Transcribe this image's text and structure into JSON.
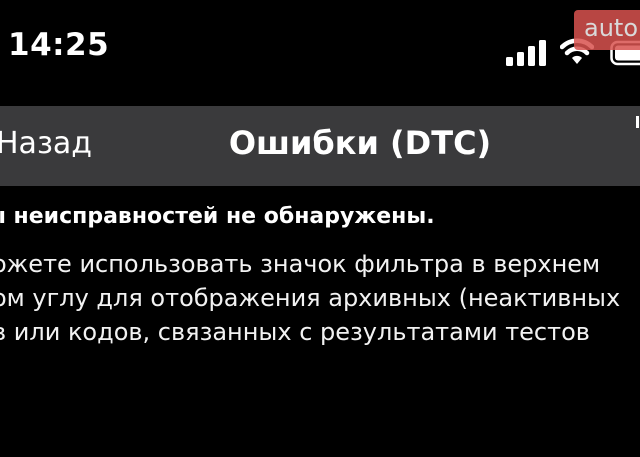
{
  "status_bar": {
    "time": "14:25",
    "icons": [
      "signal-bars-icon",
      "wifi-icon",
      "battery-icon"
    ]
  },
  "watermark": {
    "text": "auto"
  },
  "nav": {
    "back_label": "Назад",
    "title": "Ошибки (DTC)"
  },
  "message": {
    "heading": "ы неисправностей не обнаружены.",
    "lines": [
      "ожете использовать значок фильтра в верхнем",
      "ом углу для отображения архивных (неактивных",
      "в или кодов, связанных с результатами тестов"
    ]
  },
  "colors": {
    "background": "#000000",
    "nav_background": "#3a3a3c",
    "text": "#ffffff"
  }
}
